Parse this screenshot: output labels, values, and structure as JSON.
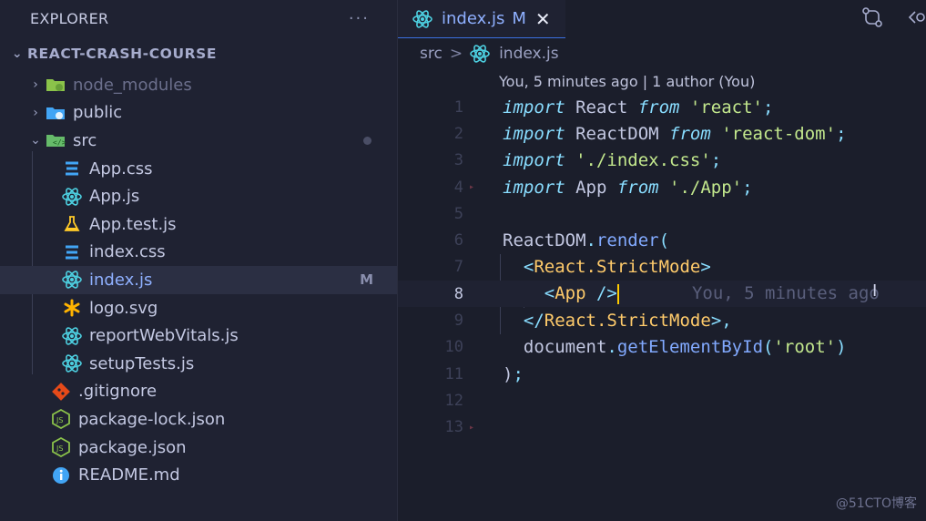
{
  "sidebar": {
    "title": "EXPLORER",
    "more_label": "···",
    "project": "REACT-CRASH-COURSE",
    "items": [
      {
        "label": "node_modules",
        "icon": "folder-node-icon",
        "kind": "folder",
        "dim": true
      },
      {
        "label": "public",
        "icon": "folder-public-icon",
        "kind": "folder"
      },
      {
        "label": "src",
        "icon": "folder-src-icon",
        "kind": "folder-open"
      },
      {
        "label": "App.css",
        "icon": "css-file-icon"
      },
      {
        "label": "App.js",
        "icon": "react-file-icon"
      },
      {
        "label": "App.test.js",
        "icon": "test-flask-icon"
      },
      {
        "label": "index.css",
        "icon": "css-file-icon"
      },
      {
        "label": "index.js",
        "icon": "react-file-icon",
        "badge": "M",
        "active": true
      },
      {
        "label": "logo.svg",
        "icon": "svg-asterisk-icon"
      },
      {
        "label": "reportWebVitals.js",
        "icon": "react-file-icon"
      },
      {
        "label": "setupTests.js",
        "icon": "react-file-icon"
      },
      {
        "label": ".gitignore",
        "icon": "git-icon"
      },
      {
        "label": "package-lock.json",
        "icon": "nodejs-icon"
      },
      {
        "label": "package.json",
        "icon": "nodejs-icon"
      },
      {
        "label": "README.md",
        "icon": "info-icon"
      }
    ]
  },
  "editor": {
    "tab": {
      "label": "index.js",
      "status": "M",
      "close": "✕"
    },
    "breadcrumb": {
      "folder": "src",
      "sep": ">",
      "file": "index.js"
    },
    "blame": "You, 5 minutes ago | 1 author (You)",
    "inline_blame": "You, 5 minutes ago",
    "line_numbers": [
      "1",
      "2",
      "3",
      "4",
      "5",
      "6",
      "7",
      "8",
      "9",
      "10",
      "11",
      "12",
      "13"
    ],
    "current_line": "8",
    "code": {
      "l1": {
        "kw1": "import",
        "id": " React ",
        "kw2": "from",
        "str": " 'react'",
        "punc": ";"
      },
      "l2": {
        "kw1": "import",
        "id": " ReactDOM ",
        "kw2": "from",
        "str": " 'react-dom'",
        "punc": ";"
      },
      "l3": {
        "kw1": "import",
        "str": " './index.css'",
        "punc": ";"
      },
      "l4": {
        "kw1": "import",
        "id": " App ",
        "kw2": "from",
        "str": " './App'",
        "punc": ";"
      },
      "l6": {
        "obj": "ReactDOM",
        "dot": ".",
        "fn": "render",
        "paren": "("
      },
      "l7": {
        "lt": "<",
        "name": "React.StrictMode",
        "gt": ">"
      },
      "l8": {
        "lt": "<",
        "name": "App",
        "close": " />"
      },
      "l9": {
        "lt": "</",
        "name": "React.StrictMode",
        "gt": ">",
        "comma": ","
      },
      "l10": {
        "obj": "document",
        "dot": ".",
        "fn": "getElementById",
        "p1": "(",
        "str": "'root'",
        "p2": ")"
      },
      "l11": {
        "paren": ")",
        "semi": ";"
      }
    }
  },
  "watermark": "@51CTO博客",
  "colors": {
    "accent": "#3b6fe0",
    "keyword": "#89ddff",
    "string": "#c3e88d",
    "function": "#82aaff",
    "tag": "#f07178"
  }
}
